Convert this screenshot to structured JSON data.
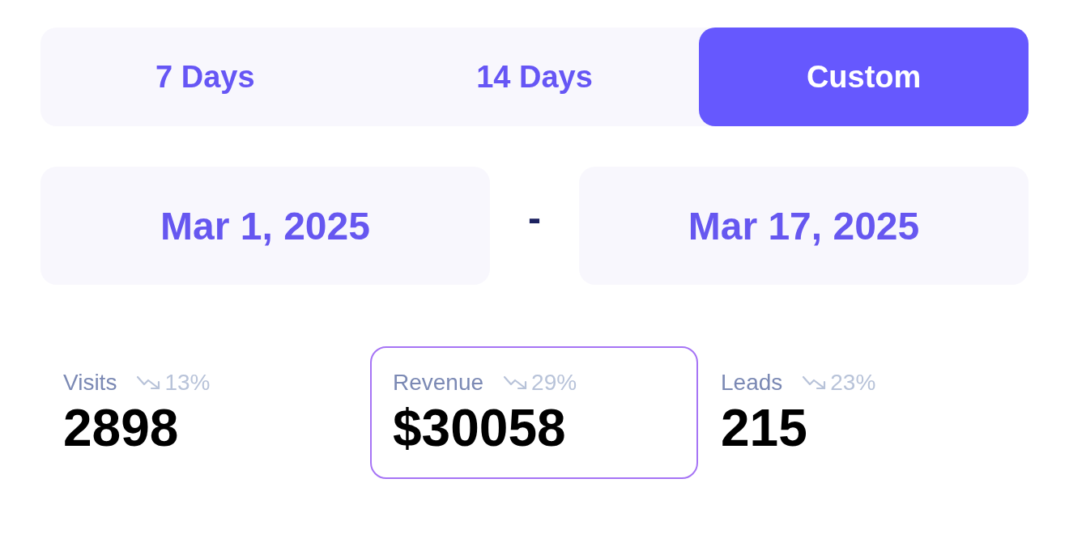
{
  "range_tabs": [
    {
      "label": "7 Days",
      "selected": false
    },
    {
      "label": "14 Days",
      "selected": false
    },
    {
      "label": "Custom",
      "selected": true
    }
  ],
  "date_range": {
    "start": "Mar 1, 2025",
    "separator": "-",
    "end": "Mar 17, 2025"
  },
  "metrics": [
    {
      "label": "Visits",
      "change": "13%",
      "value": "2898",
      "selected": false
    },
    {
      "label": "Revenue",
      "change": "29%",
      "value": "$30058",
      "selected": true
    },
    {
      "label": "Leads",
      "change": "23%",
      "value": "215",
      "selected": false
    }
  ]
}
